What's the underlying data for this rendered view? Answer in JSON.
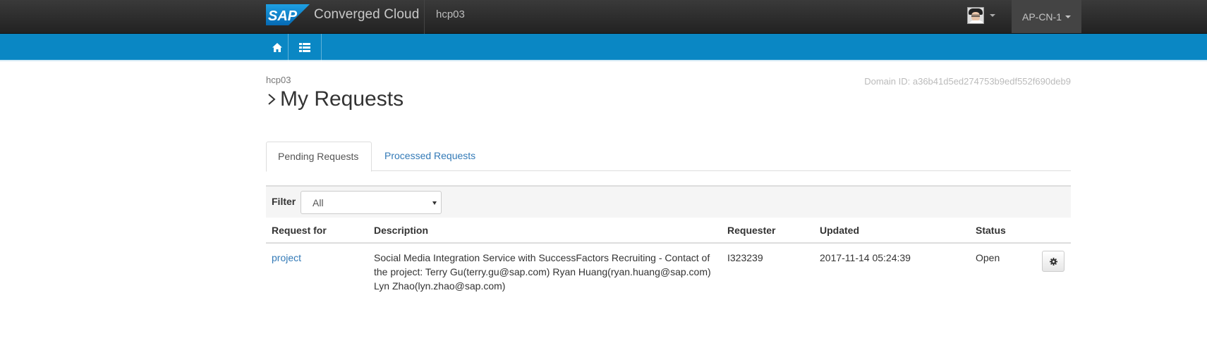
{
  "navbar": {
    "logo_text": "SAP",
    "brand": "Converged Cloud",
    "project": "hcp03",
    "region": "AP-CN-1"
  },
  "toolbar": {
    "home_icon": "home-icon",
    "list_icon": "list-icon"
  },
  "page": {
    "breadcrumb": "hcp03",
    "domain_id": "Domain ID: a36b41d5ed274753b9edf552f690deb9",
    "title": "My Requests"
  },
  "tabs": [
    {
      "label": "Pending Requests",
      "active": true
    },
    {
      "label": "Processed Requests",
      "active": false
    }
  ],
  "filter": {
    "label": "Filter",
    "selected": "All"
  },
  "table": {
    "headers": [
      "Request for",
      "Description",
      "Requester",
      "Updated",
      "Status"
    ],
    "rows": [
      {
        "request_for": "project",
        "description": "Social Media Integration Service with SuccessFactors Recruiting - Contact of the project: Terry Gu(terry.gu@sap.com) Ryan Huang(ryan.huang@sap.com) Lyn Zhao(lyn.zhao@sap.com)",
        "requester": "I323239",
        "updated": "2017-11-14 05:24:39",
        "status": "Open"
      }
    ]
  },
  "colors": {
    "accent": "#0a87c4",
    "link": "#337ab7",
    "navbar": "#2b2b2b"
  }
}
